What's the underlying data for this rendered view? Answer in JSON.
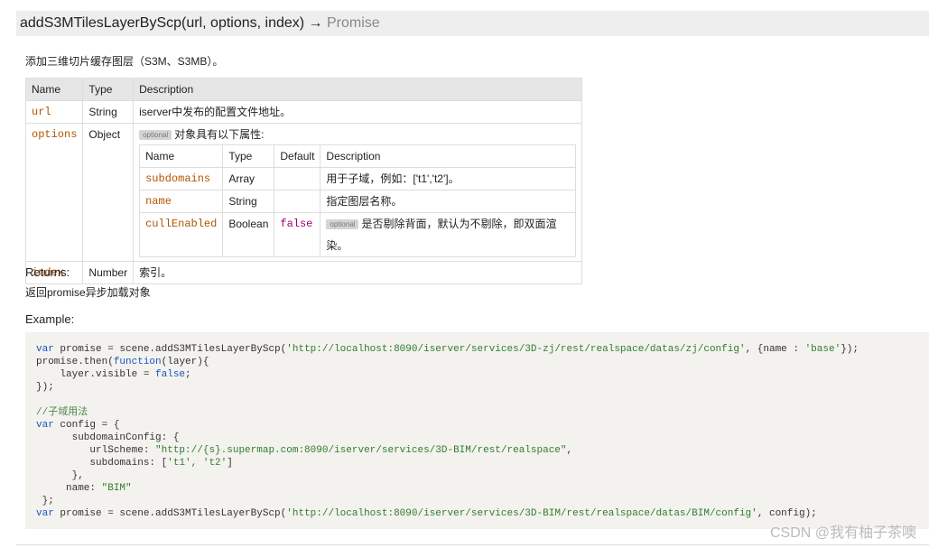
{
  "signature": {
    "name_args": "addS3MTilesLayerByScp(url, options, index)",
    "arrow": " → ",
    "return_type": "Promise"
  },
  "description": "添加三维切片缓存图层（S3M、S3MB）。",
  "params_table": {
    "headers": [
      "Name",
      "Type",
      "Description"
    ],
    "url": {
      "name": "url",
      "type": "String",
      "desc": "iserver中发布的配置文件地址。"
    },
    "options": {
      "name": "options",
      "type": "Object",
      "badge": "optional",
      "desc": "对象具有以下属性:",
      "sub_headers": [
        "Name",
        "Type",
        "Default",
        "Description"
      ],
      "rows": [
        {
          "name": "subdomains",
          "type": "Array",
          "default": "",
          "desc": "用于子域，例如：['t1','t2']。"
        },
        {
          "name": "name",
          "type": "String",
          "default": "",
          "desc": "指定图层名称。"
        },
        {
          "name": "cullEnabled",
          "type": "Boolean",
          "default": "false",
          "badge": "optional",
          "desc": "是否剔除背面，默认为不剔除，即双面渲染。"
        }
      ]
    },
    "index": {
      "name": "index",
      "type": "Number",
      "desc": "索引。"
    }
  },
  "returns_heading": "Returns:",
  "returns_text": "返回promise异步加载对象",
  "example_heading": "Example:",
  "code": {
    "l1_kw": "var",
    "l1_a": " promise = scene.addS3MTilesLayerByScp(",
    "l1_s": "'http://localhost:8090/iserver/services/3D-zj/rest/realspace/datas/zj/config'",
    "l1_b": ", {name : ",
    "l1_s2": "'base'",
    "l1_c": "});",
    "l2_a": "promise.then(",
    "l2_kw": "function",
    "l2_b": "(layer){",
    "l3_a": "    layer.visible = ",
    "l3_kw": "false",
    "l3_b": ";",
    "l4": "});",
    "l5": "",
    "l6": "//子域用法",
    "l7_kw": "var",
    "l7_a": " config = {",
    "l8": "      subdomainConfig: {",
    "l9_a": "         urlScheme: ",
    "l9_s": "\"http://{s}.supermap.com:8090/iserver/services/3D-BIM/rest/realspace\"",
    "l9_b": ",",
    "l10_a": "         subdomains: [",
    "l10_s": "'t1', 't2'",
    "l10_b": "]",
    "l11": "      },",
    "l12_a": "     name: ",
    "l12_s": "\"BIM\"",
    "l13": " };",
    "l14_kw": "var",
    "l14_a": " promise = scene.addS3MTilesLayerByScp(",
    "l14_s": "'http://localhost:8090/iserver/services/3D-BIM/rest/realspace/datas/BIM/config'",
    "l14_b": ", config);"
  },
  "watermark": "CSDN @我有柚子茶噢"
}
